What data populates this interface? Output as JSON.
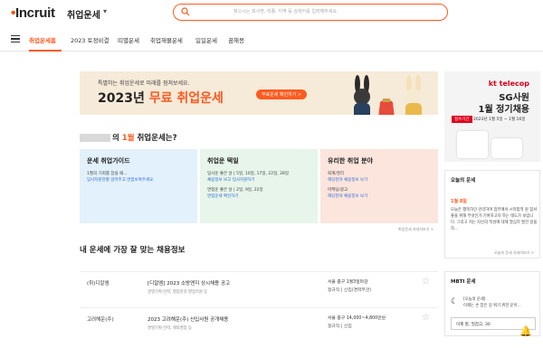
{
  "header": {
    "logo": "Incruit",
    "app_title": "취업운세",
    "search_placeholder": "찾으시는 회사명, 직종, 지역 등 검색어를 입력해주세요."
  },
  "nav": {
    "items": [
      "취업운세홈",
      "2023 토정비결",
      "띠별운세",
      "취업재물운세",
      "일일운세",
      "꿈해몽"
    ]
  },
  "banner": {
    "subtitle": "특별하는 취업운세로 미래를 점쳐보세요.",
    "title_pre": "2023년 ",
    "title_em": "무료 취업운세",
    "button": "무료운세 확인하기 >"
  },
  "ad": {
    "brand": "kt telecop",
    "title1": "SG사원",
    "title2": "1월 정기채용",
    "badge": "접수기간",
    "dates": "2023년 1월 5일 ~ 1월 16일"
  },
  "question": {
    "pre": "의 ",
    "month": "1월",
    "post": " 취업운세는?"
  },
  "cards": [
    {
      "title": "운세 취업가이드",
      "lines": [
        "1월의 기회를 잡을 때...",
        "입사지원현황 알려주고 면접보여주세요"
      ],
      "links": []
    },
    {
      "title": "취업운 택일",
      "lines": [
        "입사운 좋은 날 | 5일, 10일, 17일, 22일, 28일",
        "면접운 좋은 날 | 2일, 9일, 22일"
      ],
      "links": [
        "채용정보 보고 입사지원하기",
        "면접운세 확인하기"
      ]
    },
    {
      "title": "유리한 취업 분야",
      "lines": [
        "회계/경리",
        "마케팅/광고"
      ],
      "links": [
        "해당분야 채용정보 보기",
        "해당분야 채용정보 보기"
      ]
    }
  ],
  "card_note": "취업운세 자세히보기 >",
  "side_fortune": {
    "title": "오늘의 운세",
    "highlight": "1월 8일",
    "text": "오늘은 행복하던 관리하여 업무에서 시작합적 원 힘서 좋을 위해 무엇인가 기여하고자 하는 태도가 보입니다. 그리고 저는 자신의 적성에 대해 열심히 발전 일을 하...",
    "more": "오늘의 운세 자세히보기 >"
  },
  "section_title": "내 운세에 가장 잘 맞는 채용정보",
  "jobs": [
    {
      "company": "(취)디알엠",
      "title": "[디알엠] 2023 소방엔지 상시채용 공고",
      "detail": "경영기획·전략, 영업관리·영업지원 등",
      "location": "서울 중구 1월3일마감",
      "extra": "정규직 | 신입(경력무관)"
    },
    {
      "company": "고려해운(주)",
      "title": "2023 고려해운(주) 신입사원 공개채용",
      "detail": "경영기획·전략, 해외영업 등",
      "location": "서울 중구 14,000~4,800만원",
      "extra": "정규직 | 신입"
    }
  ],
  "side_mbti": {
    "title": "MBTI 운세",
    "moon_icon": "moon-icon",
    "line1": "[오늘의 운세]",
    "line2": "이제는 손 잡은 길 위기 위한 운이...",
    "input": "이제 할, 밀잡고, 30"
  }
}
